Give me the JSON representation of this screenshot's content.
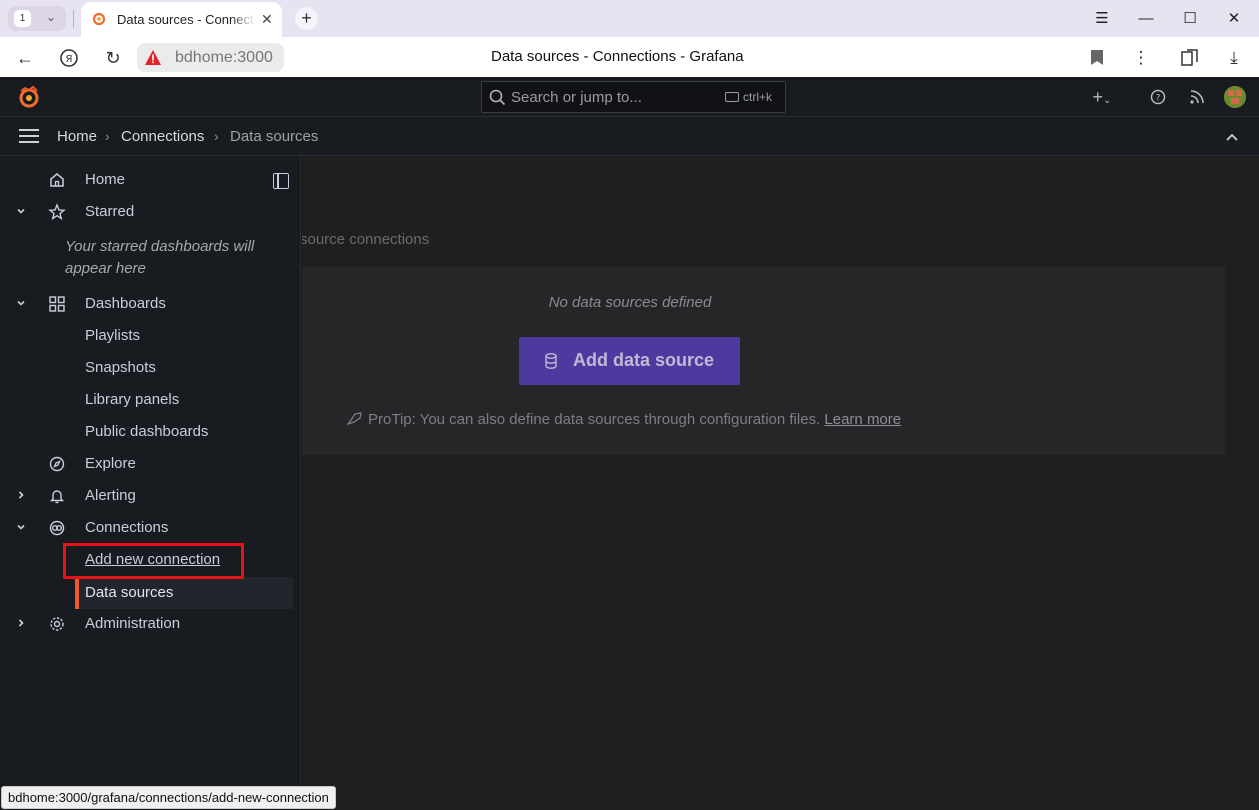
{
  "browser": {
    "tab_count": "1",
    "tab_title": "Data sources - Connections - Grafana",
    "url_host": "bdhome:3000",
    "page_title": "Data sources - Connections - Grafana",
    "status_url": "bdhome:3000/grafana/connections/add-new-connection"
  },
  "grafana": {
    "search_placeholder": "Search or jump to...",
    "search_shortcut": "ctrl+k",
    "breadcrumb": [
      "Home",
      "Connections",
      "Data sources"
    ],
    "sidebar": {
      "home": "Home",
      "starred": "Starred",
      "starred_empty": "Your starred dashboards will appear here",
      "dashboards": "Dashboards",
      "playlists": "Playlists",
      "snapshots": "Snapshots",
      "library_panels": "Library panels",
      "public_dashboards": "Public dashboards",
      "explore": "Explore",
      "alerting": "Alerting",
      "connections": "Connections",
      "add_new_connection": "Add new connection",
      "data_sources": "Data sources",
      "administration": "Administration"
    },
    "main": {
      "subtitle_fragment": "source connections",
      "empty_message": "No data sources defined",
      "add_button": "Add data source",
      "protip": "ProTip: You can also define data sources through configuration files.",
      "learn_more": "Learn more"
    }
  },
  "colors": {
    "accent_orange": "#f05a28",
    "primary_button": "#4e3a9e",
    "highlight_red": "#e8101a"
  }
}
